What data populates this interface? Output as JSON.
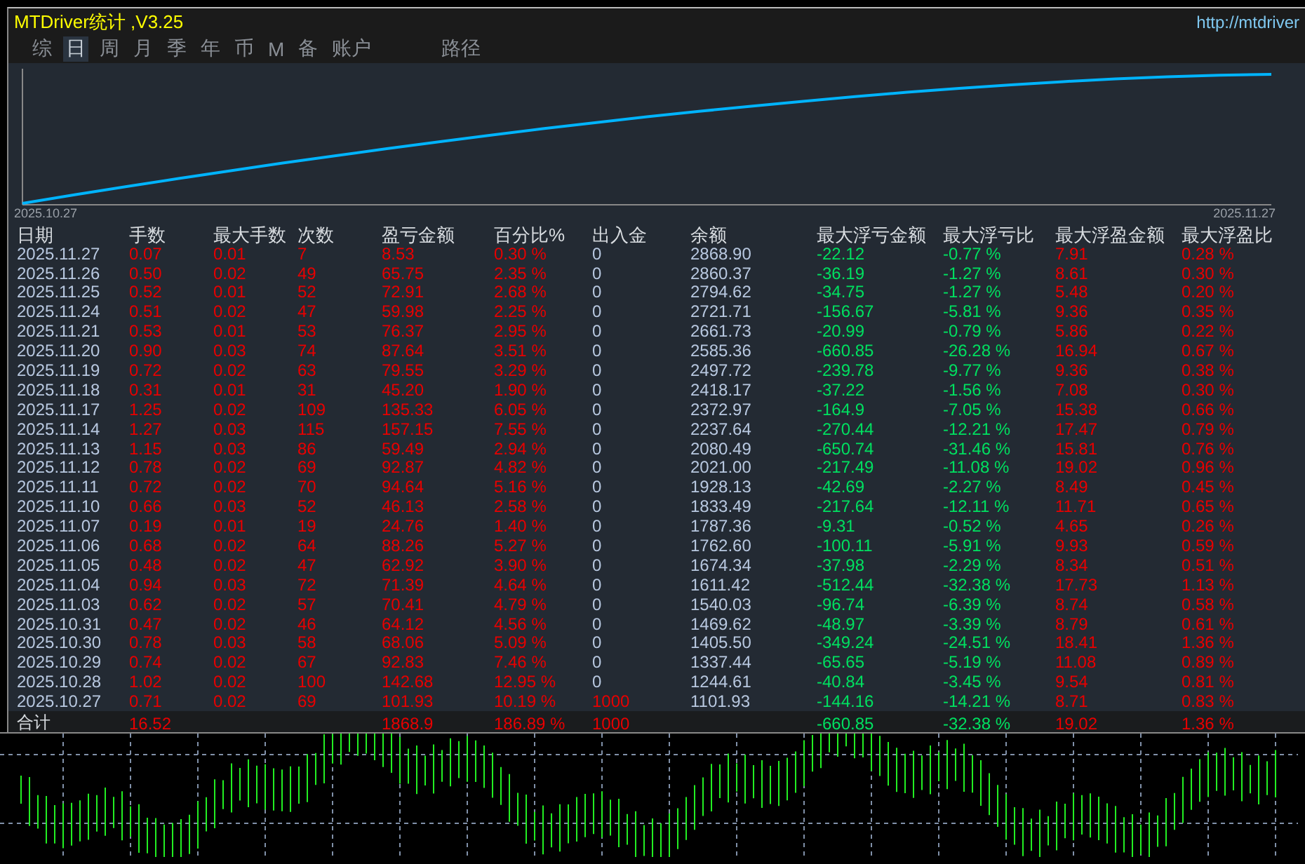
{
  "window": {
    "title": "MTDriver统计 ,V3.25",
    "url": "http://mtdriver"
  },
  "tabs": [
    {
      "label": "综",
      "selected": false
    },
    {
      "label": "日",
      "selected": true
    },
    {
      "label": "周",
      "selected": false
    },
    {
      "label": "月",
      "selected": false
    },
    {
      "label": "季",
      "selected": false
    },
    {
      "label": "年",
      "selected": false
    },
    {
      "label": "币",
      "selected": false
    },
    {
      "label": "M",
      "selected": false
    },
    {
      "label": "备",
      "selected": false
    },
    {
      "label": "账户",
      "selected": false
    },
    {
      "label": "路径",
      "selected": false
    }
  ],
  "equity_chart": {
    "start_label": "2025.10.27",
    "end_label": "2025.11.27"
  },
  "table": {
    "columns": [
      {
        "label": "日期",
        "color": "#b8c8e0"
      },
      {
        "label": "手数",
        "color": "#e80000"
      },
      {
        "label": "最大手数",
        "color": "#e80000"
      },
      {
        "label": "次数",
        "color": "#e80000"
      },
      {
        "label": "盈亏金额",
        "color": "#e80000"
      },
      {
        "label": "百分比%",
        "color": "#e80000"
      },
      {
        "label": "出入金",
        "color": "#b8c8e0"
      },
      {
        "label": "余额",
        "color": "#b8c8e0"
      },
      {
        "label": "最大浮亏金额",
        "color": "#00e060"
      },
      {
        "label": "最大浮亏比",
        "color": "#00e060"
      },
      {
        "label": "最大浮盈金额",
        "color": "#e80000"
      },
      {
        "label": "最大浮盈比",
        "color": "#e80000"
      }
    ],
    "rows": [
      {
        "deposit": false,
        "cells": [
          "2025.11.27",
          "0.07",
          "0.01",
          "7",
          "8.53",
          "0.30 %",
          "0",
          "2868.90",
          "-22.12",
          "-0.77 %",
          "7.91",
          "0.28 %"
        ]
      },
      {
        "deposit": false,
        "cells": [
          "2025.11.26",
          "0.50",
          "0.02",
          "49",
          "65.75",
          "2.35 %",
          "0",
          "2860.37",
          "-36.19",
          "-1.27 %",
          "8.61",
          "0.30 %"
        ]
      },
      {
        "deposit": false,
        "cells": [
          "2025.11.25",
          "0.52",
          "0.01",
          "52",
          "72.91",
          "2.68 %",
          "0",
          "2794.62",
          "-34.75",
          "-1.27 %",
          "5.48",
          "0.20 %"
        ]
      },
      {
        "deposit": false,
        "cells": [
          "2025.11.24",
          "0.51",
          "0.02",
          "47",
          "59.98",
          "2.25 %",
          "0",
          "2721.71",
          "-156.67",
          "-5.81 %",
          "9.36",
          "0.35 %"
        ]
      },
      {
        "deposit": false,
        "cells": [
          "2025.11.21",
          "0.53",
          "0.01",
          "53",
          "76.37",
          "2.95 %",
          "0",
          "2661.73",
          "-20.99",
          "-0.79 %",
          "5.86",
          "0.22 %"
        ]
      },
      {
        "deposit": false,
        "cells": [
          "2025.11.20",
          "0.90",
          "0.03",
          "74",
          "87.64",
          "3.51 %",
          "0",
          "2585.36",
          "-660.85",
          "-26.28 %",
          "16.94",
          "0.67 %"
        ]
      },
      {
        "deposit": false,
        "cells": [
          "2025.11.19",
          "0.72",
          "0.02",
          "63",
          "79.55",
          "3.29 %",
          "0",
          "2497.72",
          "-239.78",
          "-9.77 %",
          "9.36",
          "0.38 %"
        ]
      },
      {
        "deposit": false,
        "cells": [
          "2025.11.18",
          "0.31",
          "0.01",
          "31",
          "45.20",
          "1.90 %",
          "0",
          "2418.17",
          "-37.22",
          "-1.56 %",
          "7.08",
          "0.30 %"
        ]
      },
      {
        "deposit": false,
        "cells": [
          "2025.11.17",
          "1.25",
          "0.02",
          "109",
          "135.33",
          "6.05 %",
          "0",
          "2372.97",
          "-164.9",
          "-7.05 %",
          "15.38",
          "0.66 %"
        ]
      },
      {
        "deposit": false,
        "cells": [
          "2025.11.14",
          "1.27",
          "0.03",
          "115",
          "157.15",
          "7.55 %",
          "0",
          "2237.64",
          "-270.44",
          "-12.21 %",
          "17.47",
          "0.79 %"
        ]
      },
      {
        "deposit": false,
        "cells": [
          "2025.11.13",
          "1.15",
          "0.03",
          "86",
          "59.49",
          "2.94 %",
          "0",
          "2080.49",
          "-650.74",
          "-31.46 %",
          "15.81",
          "0.76 %"
        ]
      },
      {
        "deposit": false,
        "cells": [
          "2025.11.12",
          "0.78",
          "0.02",
          "69",
          "92.87",
          "4.82 %",
          "0",
          "2021.00",
          "-217.49",
          "-11.08 %",
          "19.02",
          "0.96 %"
        ]
      },
      {
        "deposit": false,
        "cells": [
          "2025.11.11",
          "0.72",
          "0.02",
          "70",
          "94.64",
          "5.16 %",
          "0",
          "1928.13",
          "-42.69",
          "-2.27 %",
          "8.49",
          "0.45 %"
        ]
      },
      {
        "deposit": false,
        "cells": [
          "2025.11.10",
          "0.66",
          "0.03",
          "52",
          "46.13",
          "2.58 %",
          "0",
          "1833.49",
          "-217.64",
          "-12.11 %",
          "11.71",
          "0.65 %"
        ]
      },
      {
        "deposit": false,
        "cells": [
          "2025.11.07",
          "0.19",
          "0.01",
          "19",
          "24.76",
          "1.40 %",
          "0",
          "1787.36",
          "-9.31",
          "-0.52 %",
          "4.65",
          "0.26 %"
        ]
      },
      {
        "deposit": false,
        "cells": [
          "2025.11.06",
          "0.68",
          "0.02",
          "64",
          "88.26",
          "5.27 %",
          "0",
          "1762.60",
          "-100.11",
          "-5.91 %",
          "9.93",
          "0.59 %"
        ]
      },
      {
        "deposit": false,
        "cells": [
          "2025.11.05",
          "0.48",
          "0.02",
          "47",
          "62.92",
          "3.90 %",
          "0",
          "1674.34",
          "-37.98",
          "-2.29 %",
          "8.34",
          "0.51 %"
        ]
      },
      {
        "deposit": false,
        "cells": [
          "2025.11.04",
          "0.94",
          "0.03",
          "72",
          "71.39",
          "4.64 %",
          "0",
          "1611.42",
          "-512.44",
          "-32.38 %",
          "17.73",
          "1.13 %"
        ]
      },
      {
        "deposit": false,
        "cells": [
          "2025.11.03",
          "0.62",
          "0.02",
          "57",
          "70.41",
          "4.79 %",
          "0",
          "1540.03",
          "-96.74",
          "-6.39 %",
          "8.74",
          "0.58 %"
        ]
      },
      {
        "deposit": false,
        "cells": [
          "2025.10.31",
          "0.47",
          "0.02",
          "46",
          "64.12",
          "4.56 %",
          "0",
          "1469.62",
          "-48.97",
          "-3.39 %",
          "8.79",
          "0.61 %"
        ]
      },
      {
        "deposit": false,
        "cells": [
          "2025.10.30",
          "0.78",
          "0.03",
          "58",
          "68.06",
          "5.09 %",
          "0",
          "1405.50",
          "-349.24",
          "-24.51 %",
          "18.41",
          "1.36 %"
        ]
      },
      {
        "deposit": false,
        "cells": [
          "2025.10.29",
          "0.74",
          "0.02",
          "67",
          "92.83",
          "7.46 %",
          "0",
          "1337.44",
          "-65.65",
          "-5.19 %",
          "11.08",
          "0.89 %"
        ]
      },
      {
        "deposit": false,
        "cells": [
          "2025.10.28",
          "1.02",
          "0.02",
          "100",
          "142.68",
          "12.95 %",
          "0",
          "1244.61",
          "-40.84",
          "-3.45 %",
          "9.54",
          "0.81 %"
        ]
      },
      {
        "deposit": true,
        "cells": [
          "2025.10.27",
          "0.71",
          "0.02",
          "69",
          "101.93",
          "10.19 %",
          "1000",
          "1101.93",
          "-144.16",
          "-14.21 %",
          "8.71",
          "0.83 %"
        ]
      }
    ],
    "totals": {
      "deposit": true,
      "cells": [
        "合计",
        "16.52",
        null,
        null,
        "1868.9",
        "186.89 %",
        "1000",
        null,
        "-660.85",
        "-32.38 %",
        "19.02",
        "1.36 %"
      ]
    }
  }
}
